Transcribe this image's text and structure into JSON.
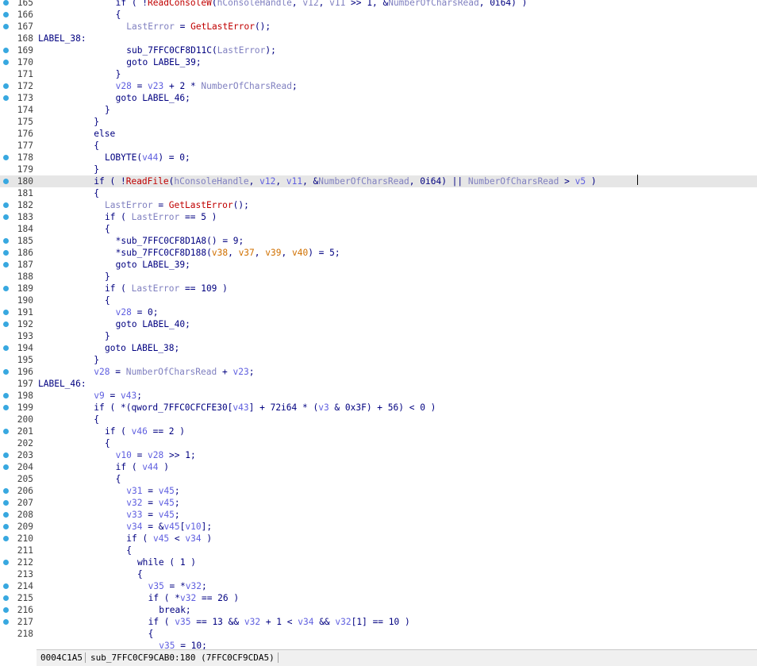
{
  "status_bar": {
    "offset": "0004C1A5",
    "location": "sub_7FFC0CF9CAB0:180 (7FFC0CF9CDA5)"
  },
  "lines": [
    {
      "n": "165",
      "bp": true,
      "label": "",
      "indent": 14,
      "tokens": [
        [
          "k",
          "if ( !"
        ],
        [
          "f",
          "ReadConsoleW"
        ],
        [
          "k",
          "("
        ],
        [
          "p",
          "hConsoleHandle"
        ],
        [
          "k",
          ", "
        ],
        [
          "p",
          "v12"
        ],
        [
          "k",
          ", "
        ],
        [
          "p",
          "v11"
        ],
        [
          "k",
          " >> 1, &"
        ],
        [
          "p",
          "NumberOfCharsRead"
        ],
        [
          "k",
          ", 0i64) )"
        ]
      ]
    },
    {
      "n": "166",
      "bp": true,
      "label": "",
      "indent": 14,
      "tokens": [
        [
          "k",
          "{"
        ]
      ]
    },
    {
      "n": "167",
      "bp": true,
      "label": "",
      "indent": 16,
      "tokens": [
        [
          "p",
          "LastError"
        ],
        [
          "k",
          " = "
        ],
        [
          "f",
          "GetLastError"
        ],
        [
          "k",
          "();"
        ]
      ]
    },
    {
      "n": "168",
      "bp": false,
      "label": "LABEL_38:",
      "indent": 0,
      "tokens": []
    },
    {
      "n": "169",
      "bp": true,
      "label": "",
      "indent": 16,
      "tokens": [
        [
          "k",
          "sub_7FFC0CF8D11C("
        ],
        [
          "p",
          "LastError"
        ],
        [
          "k",
          ");"
        ]
      ]
    },
    {
      "n": "170",
      "bp": true,
      "label": "",
      "indent": 16,
      "tokens": [
        [
          "k",
          "goto LABEL_39;"
        ]
      ]
    },
    {
      "n": "171",
      "bp": false,
      "label": "",
      "indent": 14,
      "tokens": [
        [
          "k",
          "}"
        ]
      ]
    },
    {
      "n": "172",
      "bp": true,
      "label": "",
      "indent": 14,
      "tokens": [
        [
          "v",
          "v28"
        ],
        [
          "k",
          " = "
        ],
        [
          "v",
          "v23"
        ],
        [
          "k",
          " + 2 * "
        ],
        [
          "p",
          "NumberOfCharsRead"
        ],
        [
          "k",
          ";"
        ]
      ]
    },
    {
      "n": "173",
      "bp": true,
      "label": "",
      "indent": 14,
      "tokens": [
        [
          "k",
          "goto LABEL_46;"
        ]
      ]
    },
    {
      "n": "174",
      "bp": false,
      "label": "",
      "indent": 12,
      "tokens": [
        [
          "k",
          "}"
        ]
      ]
    },
    {
      "n": "175",
      "bp": false,
      "label": "",
      "indent": 10,
      "tokens": [
        [
          "k",
          "}"
        ]
      ]
    },
    {
      "n": "176",
      "bp": false,
      "label": "",
      "indent": 10,
      "tokens": [
        [
          "k",
          "else"
        ]
      ]
    },
    {
      "n": "177",
      "bp": false,
      "label": "",
      "indent": 10,
      "tokens": [
        [
          "k",
          "{"
        ]
      ]
    },
    {
      "n": "178",
      "bp": true,
      "label": "",
      "indent": 12,
      "tokens": [
        [
          "k",
          "LOBYTE("
        ],
        [
          "v",
          "v44"
        ],
        [
          "k",
          ") = 0;"
        ]
      ]
    },
    {
      "n": "179",
      "bp": false,
      "label": "",
      "indent": 10,
      "tokens": [
        [
          "k",
          "}"
        ]
      ]
    },
    {
      "n": "180",
      "bp": true,
      "label": "",
      "indent": 10,
      "hl": true,
      "tokens": [
        [
          "k",
          "if ( !"
        ],
        [
          "f",
          "ReadFile"
        ],
        [
          "k",
          "("
        ],
        [
          "p",
          "hConsoleHandle"
        ],
        [
          "k",
          ", "
        ],
        [
          "v",
          "v12"
        ],
        [
          "k",
          ", "
        ],
        [
          "v",
          "v11"
        ],
        [
          "k",
          ", &"
        ],
        [
          "p",
          "NumberOfCharsRead"
        ],
        [
          "k",
          ", 0i64) || "
        ],
        [
          "p",
          "NumberOfCharsRead"
        ],
        [
          "k",
          " > "
        ],
        [
          "v",
          "v5"
        ],
        [
          "k",
          " )"
        ]
      ]
    },
    {
      "n": "181",
      "bp": false,
      "label": "",
      "indent": 10,
      "tokens": [
        [
          "k",
          "{"
        ]
      ]
    },
    {
      "n": "182",
      "bp": true,
      "label": "",
      "indent": 12,
      "tokens": [
        [
          "p",
          "LastError"
        ],
        [
          "k",
          " = "
        ],
        [
          "f",
          "GetLastError"
        ],
        [
          "k",
          "();"
        ]
      ]
    },
    {
      "n": "183",
      "bp": true,
      "label": "",
      "indent": 12,
      "tokens": [
        [
          "k",
          "if ( "
        ],
        [
          "p",
          "LastError"
        ],
        [
          "k",
          " == 5 )"
        ]
      ]
    },
    {
      "n": "184",
      "bp": false,
      "label": "",
      "indent": 12,
      "tokens": [
        [
          "k",
          "{"
        ]
      ]
    },
    {
      "n": "185",
      "bp": true,
      "label": "",
      "indent": 14,
      "tokens": [
        [
          "k",
          "*sub_7FFC0CF8D1A8() = 9;"
        ]
      ]
    },
    {
      "n": "186",
      "bp": true,
      "label": "",
      "indent": 14,
      "tokens": [
        [
          "k",
          "*sub_7FFC0CF8D188("
        ],
        [
          "o",
          "v38"
        ],
        [
          "k",
          ", "
        ],
        [
          "o",
          "v37"
        ],
        [
          "k",
          ", "
        ],
        [
          "o",
          "v39"
        ],
        [
          "k",
          ", "
        ],
        [
          "o",
          "v40"
        ],
        [
          "k",
          ") = 5;"
        ]
      ]
    },
    {
      "n": "187",
      "bp": true,
      "label": "",
      "indent": 14,
      "tokens": [
        [
          "k",
          "goto LABEL_39;"
        ]
      ]
    },
    {
      "n": "188",
      "bp": false,
      "label": "",
      "indent": 12,
      "tokens": [
        [
          "k",
          "}"
        ]
      ]
    },
    {
      "n": "189",
      "bp": true,
      "label": "",
      "indent": 12,
      "tokens": [
        [
          "k",
          "if ( "
        ],
        [
          "p",
          "LastError"
        ],
        [
          "k",
          " == 109 )"
        ]
      ]
    },
    {
      "n": "190",
      "bp": false,
      "label": "",
      "indent": 12,
      "tokens": [
        [
          "k",
          "{"
        ]
      ]
    },
    {
      "n": "191",
      "bp": true,
      "label": "",
      "indent": 14,
      "tokens": [
        [
          "v",
          "v28"
        ],
        [
          "k",
          " = 0;"
        ]
      ]
    },
    {
      "n": "192",
      "bp": true,
      "label": "",
      "indent": 14,
      "tokens": [
        [
          "k",
          "goto LABEL_40;"
        ]
      ]
    },
    {
      "n": "193",
      "bp": false,
      "label": "",
      "indent": 12,
      "tokens": [
        [
          "k",
          "}"
        ]
      ]
    },
    {
      "n": "194",
      "bp": true,
      "label": "",
      "indent": 12,
      "tokens": [
        [
          "k",
          "goto LABEL_38;"
        ]
      ]
    },
    {
      "n": "195",
      "bp": false,
      "label": "",
      "indent": 10,
      "tokens": [
        [
          "k",
          "}"
        ]
      ]
    },
    {
      "n": "196",
      "bp": true,
      "label": "",
      "indent": 10,
      "tokens": [
        [
          "v",
          "v28"
        ],
        [
          "k",
          " = "
        ],
        [
          "p",
          "NumberOfCharsRead"
        ],
        [
          "k",
          " + "
        ],
        [
          "v",
          "v23"
        ],
        [
          "k",
          ";"
        ]
      ]
    },
    {
      "n": "197",
      "bp": false,
      "label": "LABEL_46:",
      "indent": 0,
      "tokens": []
    },
    {
      "n": "198",
      "bp": true,
      "label": "",
      "indent": 10,
      "tokens": [
        [
          "v",
          "v9"
        ],
        [
          "k",
          " = "
        ],
        [
          "v",
          "v43"
        ],
        [
          "k",
          ";"
        ]
      ]
    },
    {
      "n": "199",
      "bp": true,
      "label": "",
      "indent": 10,
      "tokens": [
        [
          "k",
          "if ( *(qword_7FFC0CFCFE30["
        ],
        [
          "v",
          "v43"
        ],
        [
          "k",
          "] + 72i64 * ("
        ],
        [
          "v",
          "v3"
        ],
        [
          "k",
          " & 0x3F) + 56) < 0 )"
        ]
      ]
    },
    {
      "n": "200",
      "bp": false,
      "label": "",
      "indent": 10,
      "tokens": [
        [
          "k",
          "{"
        ]
      ]
    },
    {
      "n": "201",
      "bp": true,
      "label": "",
      "indent": 12,
      "tokens": [
        [
          "k",
          "if ( "
        ],
        [
          "v",
          "v46"
        ],
        [
          "k",
          " == 2 )"
        ]
      ]
    },
    {
      "n": "202",
      "bp": false,
      "label": "",
      "indent": 12,
      "tokens": [
        [
          "k",
          "{"
        ]
      ]
    },
    {
      "n": "203",
      "bp": true,
      "label": "",
      "indent": 14,
      "tokens": [
        [
          "v",
          "v10"
        ],
        [
          "k",
          " = "
        ],
        [
          "v",
          "v28"
        ],
        [
          "k",
          " >> 1;"
        ]
      ]
    },
    {
      "n": "204",
      "bp": true,
      "label": "",
      "indent": 14,
      "tokens": [
        [
          "k",
          "if ( "
        ],
        [
          "v",
          "v44"
        ],
        [
          "k",
          " )"
        ]
      ]
    },
    {
      "n": "205",
      "bp": false,
      "label": "",
      "indent": 14,
      "tokens": [
        [
          "k",
          "{"
        ]
      ]
    },
    {
      "n": "206",
      "bp": true,
      "label": "",
      "indent": 16,
      "tokens": [
        [
          "v",
          "v31"
        ],
        [
          "k",
          " = "
        ],
        [
          "v",
          "v45"
        ],
        [
          "k",
          ";"
        ]
      ]
    },
    {
      "n": "207",
      "bp": true,
      "label": "",
      "indent": 16,
      "tokens": [
        [
          "v",
          "v32"
        ],
        [
          "k",
          " = "
        ],
        [
          "v",
          "v45"
        ],
        [
          "k",
          ";"
        ]
      ]
    },
    {
      "n": "208",
      "bp": true,
      "label": "",
      "indent": 16,
      "tokens": [
        [
          "v",
          "v33"
        ],
        [
          "k",
          " = "
        ],
        [
          "v",
          "v45"
        ],
        [
          "k",
          ";"
        ]
      ]
    },
    {
      "n": "209",
      "bp": true,
      "label": "",
      "indent": 16,
      "tokens": [
        [
          "v",
          "v34"
        ],
        [
          "k",
          " = &"
        ],
        [
          "v",
          "v45"
        ],
        [
          "k",
          "["
        ],
        [
          "v",
          "v10"
        ],
        [
          "k",
          "];"
        ]
      ]
    },
    {
      "n": "210",
      "bp": true,
      "label": "",
      "indent": 16,
      "tokens": [
        [
          "k",
          "if ( "
        ],
        [
          "v",
          "v45"
        ],
        [
          "k",
          " < "
        ],
        [
          "v",
          "v34"
        ],
        [
          "k",
          " )"
        ]
      ]
    },
    {
      "n": "211",
      "bp": false,
      "label": "",
      "indent": 16,
      "tokens": [
        [
          "k",
          "{"
        ]
      ]
    },
    {
      "n": "212",
      "bp": true,
      "label": "",
      "indent": 18,
      "tokens": [
        [
          "k",
          "while ( 1 )"
        ]
      ]
    },
    {
      "n": "213",
      "bp": false,
      "label": "",
      "indent": 18,
      "tokens": [
        [
          "k",
          "{"
        ]
      ]
    },
    {
      "n": "214",
      "bp": true,
      "label": "",
      "indent": 20,
      "tokens": [
        [
          "v",
          "v35"
        ],
        [
          "k",
          " = *"
        ],
        [
          "v",
          "v32"
        ],
        [
          "k",
          ";"
        ]
      ]
    },
    {
      "n": "215",
      "bp": true,
      "label": "",
      "indent": 20,
      "tokens": [
        [
          "k",
          "if ( *"
        ],
        [
          "v",
          "v32"
        ],
        [
          "k",
          " == 26 )"
        ]
      ]
    },
    {
      "n": "216",
      "bp": true,
      "label": "",
      "indent": 22,
      "tokens": [
        [
          "k",
          "break;"
        ]
      ]
    },
    {
      "n": "217",
      "bp": true,
      "label": "",
      "indent": 20,
      "tokens": [
        [
          "k",
          "if ( "
        ],
        [
          "v",
          "v35"
        ],
        [
          "k",
          " == 13 && "
        ],
        [
          "v",
          "v32"
        ],
        [
          "k",
          " + 1 < "
        ],
        [
          "v",
          "v34"
        ],
        [
          "k",
          " && "
        ],
        [
          "v",
          "v32"
        ],
        [
          "k",
          "[1] == 10 )"
        ]
      ]
    },
    {
      "n": "218",
      "bp": false,
      "label": "",
      "indent": 20,
      "tokens": [
        [
          "k",
          "{"
        ]
      ]
    },
    {
      "n": "",
      "bp": false,
      "label": "",
      "indent": 22,
      "tokens": [
        [
          "v",
          "v35"
        ],
        [
          "k",
          " = 10;"
        ]
      ]
    }
  ]
}
